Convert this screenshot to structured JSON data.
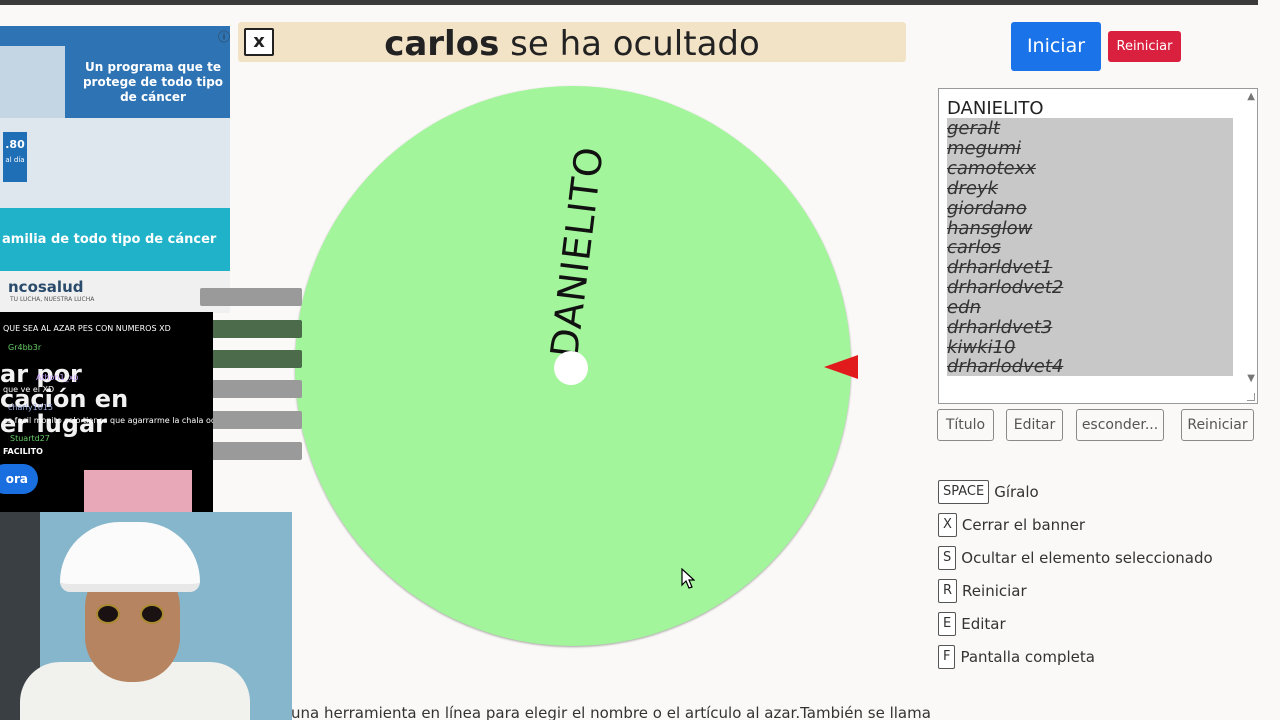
{
  "banner": {
    "name": "carlos",
    "rest": "se ha ocultado",
    "close_label": "x"
  },
  "controls": {
    "start_label": "Iniciar",
    "reset_label": "Reiniciar"
  },
  "wheel": {
    "segment_label": "DANIELITO",
    "color": "#a2f59a",
    "pointer_color": "#e11b1b"
  },
  "names": {
    "first": "DANIELITO",
    "hidden": [
      "geralt",
      "megumi",
      "camotexx",
      "dreyk",
      "giordano",
      "hansglow",
      "carlos",
      "drharldvet1",
      "drharlodvet2",
      "edn",
      "drharldvet3",
      "kiwki10",
      "drharlodvet4"
    ]
  },
  "toolbar": {
    "title": "Título",
    "edit": "Editar",
    "hide": "esconder...",
    "reset": "Reiniciar"
  },
  "shortcuts": [
    {
      "key": "SPACE",
      "desc": "Gíralo"
    },
    {
      "key": "X",
      "desc": "Cerrar el banner"
    },
    {
      "key": "S",
      "desc": "Ocultar el elemento seleccionado"
    },
    {
      "key": "R",
      "desc": "Reiniciar"
    },
    {
      "key": "E",
      "desc": "Editar"
    },
    {
      "key": "F",
      "desc": "Pantalla completa"
    }
  ],
  "footer_text": "una herramienta en línea para elegir el nombre o el artículo al azar.También se llama",
  "ad": {
    "headline": "Un programa que te protege de todo tipo de cáncer",
    "price": ".80",
    "price_unit": "al día",
    "caption": "amilia de todo tipo de cáncer",
    "brand": "ncosalud",
    "tagline": "TU LUCHA, NUESTRA LUCHA"
  },
  "chat": {
    "messages": [
      {
        "user": "",
        "text": "QUE SEA AL AZAR PES CON NUMEROS XD"
      },
      {
        "user": "Gr4bb3r",
        "text": ""
      },
      {
        "user": "Athon1_xp",
        "text": "que ve el XD"
      },
      {
        "user": "charly1015",
        "text": "es facil monito solo tienes que agarrarme la chala oqueyno monito xd"
      },
      {
        "user": "Stuartd27",
        "text": "FACILITO"
      }
    ],
    "promo_line1": "ar por",
    "promo_line2": "cación en",
    "promo_line3": "er lugar",
    "promo_button": "ora"
  }
}
